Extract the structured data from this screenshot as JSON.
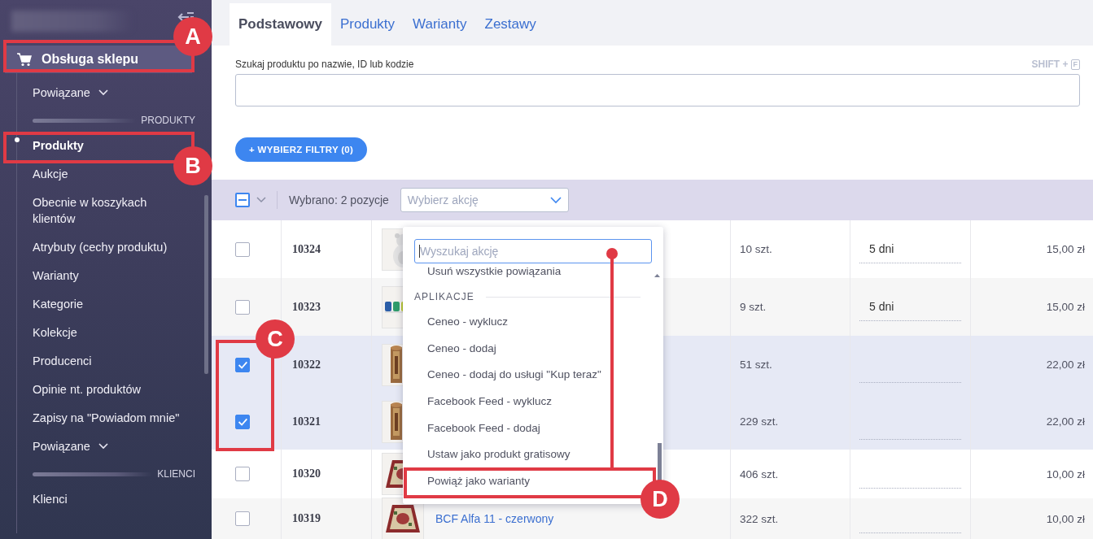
{
  "sidebar": {
    "section": {
      "label": "Obsługa sklepu",
      "selected": true
    },
    "items": [
      {
        "kind": "dropdown",
        "label": "Powiązane",
        "selected": false
      },
      {
        "kind": "divider",
        "label": "PRODUKTY"
      },
      {
        "kind": "link",
        "label": "Produkty",
        "selected": true
      },
      {
        "kind": "link",
        "label": "Aukcje",
        "selected": false
      },
      {
        "kind": "link",
        "label": "Obecnie w koszykach klientów",
        "selected": false
      },
      {
        "kind": "link",
        "label": "Atrybuty (cechy produktu)",
        "selected": false
      },
      {
        "kind": "link",
        "label": "Warianty",
        "selected": false
      },
      {
        "kind": "link",
        "label": "Kategorie",
        "selected": false
      },
      {
        "kind": "link",
        "label": "Kolekcje",
        "selected": false
      },
      {
        "kind": "link",
        "label": "Producenci",
        "selected": false
      },
      {
        "kind": "link",
        "label": "Opinie nt. produktów",
        "selected": false
      },
      {
        "kind": "link",
        "label": "Zapisy na \"Powiadom mnie\"",
        "selected": false
      },
      {
        "kind": "dropdown",
        "label": "Powiązane",
        "selected": false
      },
      {
        "kind": "divider",
        "label": "KLIENCI"
      },
      {
        "kind": "link",
        "label": "Klienci",
        "selected": false
      }
    ]
  },
  "tabs": [
    {
      "label": "Podstawowy",
      "selected": true
    },
    {
      "label": "Produkty",
      "selected": false
    },
    {
      "label": "Warianty",
      "selected": false
    },
    {
      "label": "Zestawy",
      "selected": false
    }
  ],
  "search": {
    "label": "Szukaj produktu po nazwie, ID lub kodzie",
    "shortcut": "SHIFT +",
    "shortcut_key": "F"
  },
  "filter_button": "+ WYBIERZ FILTRY (0)",
  "toolbar": {
    "indeterminate": true,
    "selection_text": "Wybrano: 2 pozycje",
    "action_placeholder": "Wybierz akcję"
  },
  "table": {
    "rows": [
      {
        "checked": false,
        "id": "10324",
        "quantity": "10 szt.",
        "delivery": "5 dni",
        "price": "15,00 zł"
      },
      {
        "checked": false,
        "id": "10323",
        "quantity": "9 szt.",
        "delivery": "5 dni",
        "price": "15,00 zł"
      },
      {
        "checked": true,
        "id": "10322",
        "quantity": "51 szt.",
        "price": "22,00 zł"
      },
      {
        "checked": true,
        "id": "10321",
        "quantity": "229 szt.",
        "price": "22,00 zł"
      },
      {
        "checked": false,
        "id": "10320",
        "quantity": "406 szt.",
        "price": "10,00 zł"
      },
      {
        "checked": false,
        "id": "10319",
        "name": "BCF Alfa 11 - czerwony",
        "quantity": "322 szt.",
        "price": "10,00 zł"
      }
    ]
  },
  "action_menu": {
    "search_placeholder": "Wyszukaj akcję",
    "items": [
      {
        "kind": "item",
        "label": "Usuń wszystkie powiązania"
      },
      {
        "kind": "group",
        "label": "APLIKACJE"
      },
      {
        "kind": "item",
        "label": "Ceneo - wyklucz"
      },
      {
        "kind": "item",
        "label": "Ceneo - dodaj"
      },
      {
        "kind": "item",
        "label": "Ceneo - dodaj do usługi \"Kup teraz\""
      },
      {
        "kind": "item",
        "label": "Facebook Feed - wyklucz"
      },
      {
        "kind": "item",
        "label": "Facebook Feed - dodaj"
      },
      {
        "kind": "item",
        "label": "Ustaw jako produkt gratisowy"
      },
      {
        "kind": "item",
        "label": "Powiąż jako warianty"
      }
    ]
  },
  "annotations": [
    {
      "label": "A"
    },
    {
      "label": "B"
    },
    {
      "label": "C"
    },
    {
      "label": "D"
    }
  ]
}
